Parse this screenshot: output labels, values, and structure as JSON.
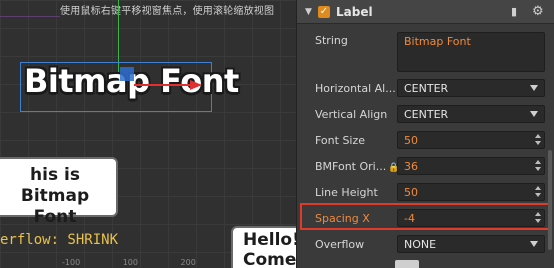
{
  "scene": {
    "hint": "使用鼠标右键平移视窗焦点，使用滚轮缩放视图",
    "bitmap_text": "Bitmap Font",
    "card1_line1": "his is Bitmap",
    "card1_line2": "Font",
    "overflow_text": "erflow: SHRINK",
    "card2_line1": "Hello!",
    "card2_line2": "Come",
    "bottom_numbers": "-100 100 200"
  },
  "inspector": {
    "component_title": "Label",
    "enabled": true,
    "props": {
      "string": {
        "label": "String",
        "value": "Bitmap Font"
      },
      "horizontal_align": {
        "label": "Horizontal Al...",
        "value": "CENTER"
      },
      "vertical_align": {
        "label": "Vertical Align",
        "value": "CENTER"
      },
      "font_size": {
        "label": "Font Size",
        "value": "50"
      },
      "bmfont_original_size": {
        "label": "BMFont Ori...",
        "value": "36"
      },
      "line_height": {
        "label": "Line Height",
        "value": "50"
      },
      "spacing_x": {
        "label": "Spacing X",
        "value": "-4"
      },
      "overflow": {
        "label": "Overflow",
        "value": "NONE"
      }
    }
  },
  "colors": {
    "accent_orange": "#f08a3a",
    "highlight_red": "#e23a2a",
    "selection_blue": "#3f7fd0"
  },
  "icons": [
    "chevron-down-icon",
    "checkbox-icon",
    "book-icon",
    "gear-icon",
    "lock-icon",
    "dropdown-arrow-icon",
    "spinner-icon"
  ]
}
